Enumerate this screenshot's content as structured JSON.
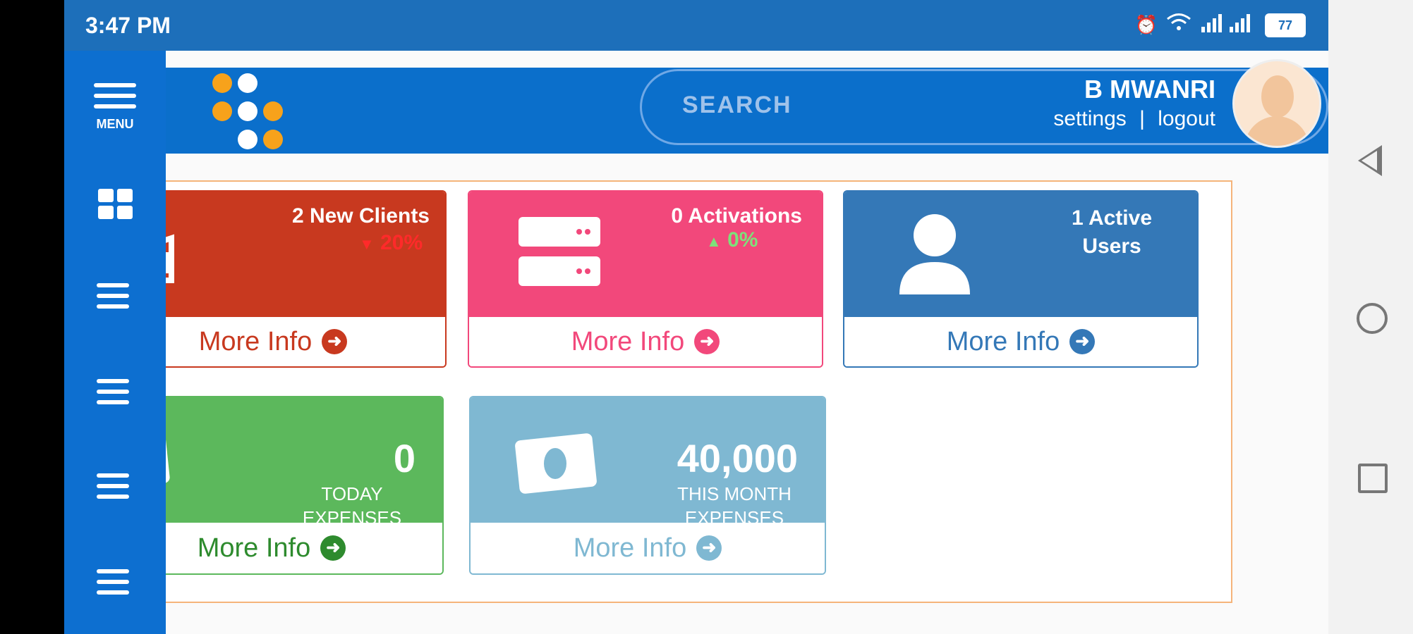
{
  "status_bar": {
    "time": "3:47 PM",
    "battery": "77"
  },
  "header": {
    "search_placeholder": "SEARCH",
    "user_name": "B MWANRI",
    "settings_link": "settings",
    "separator": "|",
    "logout_link": "logout"
  },
  "sidebar": {
    "menu_label": "MENU"
  },
  "cards": {
    "new_clients": {
      "title": "2 New Clients",
      "trend": "20%",
      "link": "More Info",
      "color": "#c8391f"
    },
    "activations": {
      "title": "0 Activations",
      "trend": "0%",
      "link": "More Info",
      "color": "#f2487b"
    },
    "active_users": {
      "title_line1": "1 Active",
      "title_line2": "Users",
      "link": "More Info",
      "color": "#3478b7"
    },
    "today_expenses": {
      "value": "0",
      "caption_line1": "TODAY",
      "caption_line2": "EXPENSES",
      "link": "More Info",
      "color": "#5cb85c"
    },
    "month_expenses": {
      "value": "40,000",
      "caption_line1": "THIS MONTH",
      "caption_line2": "EXPENSES",
      "link": "More Info",
      "color": "#7fb8d2"
    }
  },
  "icons": {
    "new_clients": "handshake-icon",
    "activations": "server-icon",
    "active_users": "user-icon",
    "expenses": "money-icon",
    "more_info": "arrow-circle-right-icon"
  }
}
